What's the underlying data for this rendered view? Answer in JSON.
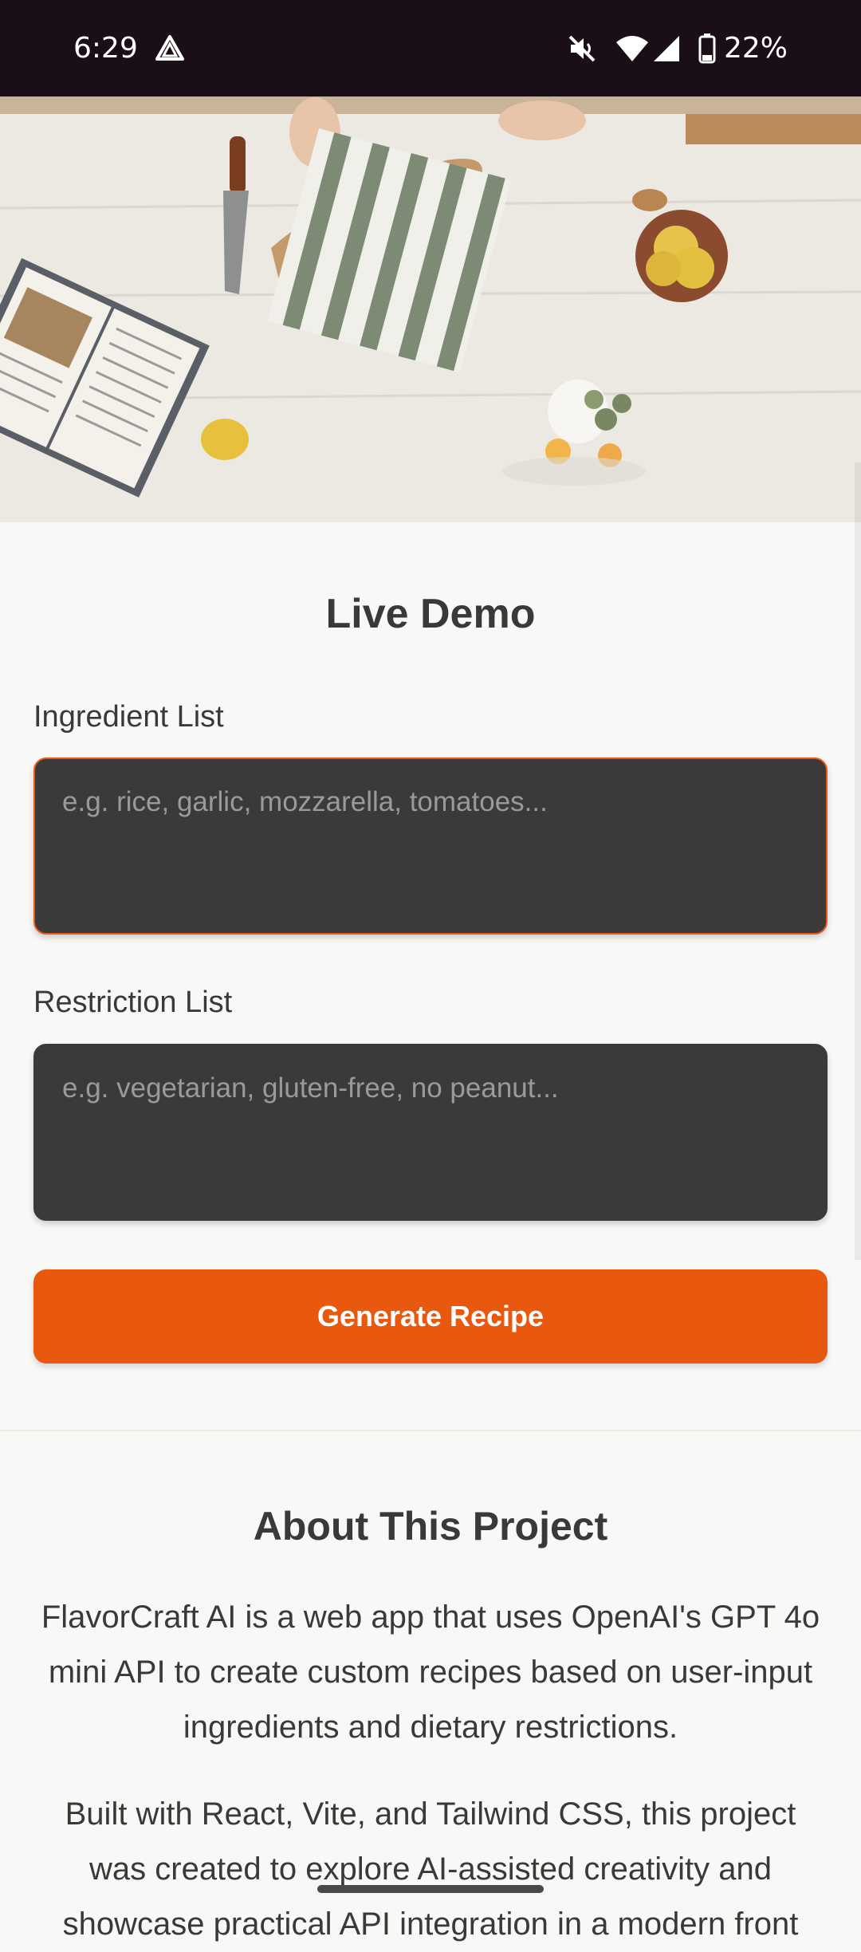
{
  "status_bar": {
    "time": "6:29",
    "battery": "22%",
    "icons": [
      "drive-alert-icon",
      "mute-icon",
      "wifi-icon",
      "signal-icon",
      "battery-icon"
    ]
  },
  "hero": {
    "image": "kitchen-table-photo"
  },
  "live_demo": {
    "title": "Live Demo",
    "ingredient_label": "Ingredient List",
    "ingredient_placeholder": "e.g. rice, garlic, mozzarella, tomatoes...",
    "restriction_label": "Restriction List",
    "restriction_placeholder": "e.g. vegetarian, gluten-free, no peanut...",
    "button_label": "Generate Recipe"
  },
  "about": {
    "title": "About This Project",
    "paragraph1": "FlavorCraft AI is a web app that uses OpenAI's GPT 4o mini API to create custom recipes based on user-input ingredients and dietary restrictions.",
    "paragraph2": "Built with React, Vite, and Tailwind CSS, this project was created to explore AI-assisted creativity and showcase practical API integration in a modern front"
  },
  "colors": {
    "accent": "#e8580e",
    "status_bar": "#1b0f17",
    "input_bg": "#3a3a3a",
    "page_bg": "#f8f8f6"
  }
}
